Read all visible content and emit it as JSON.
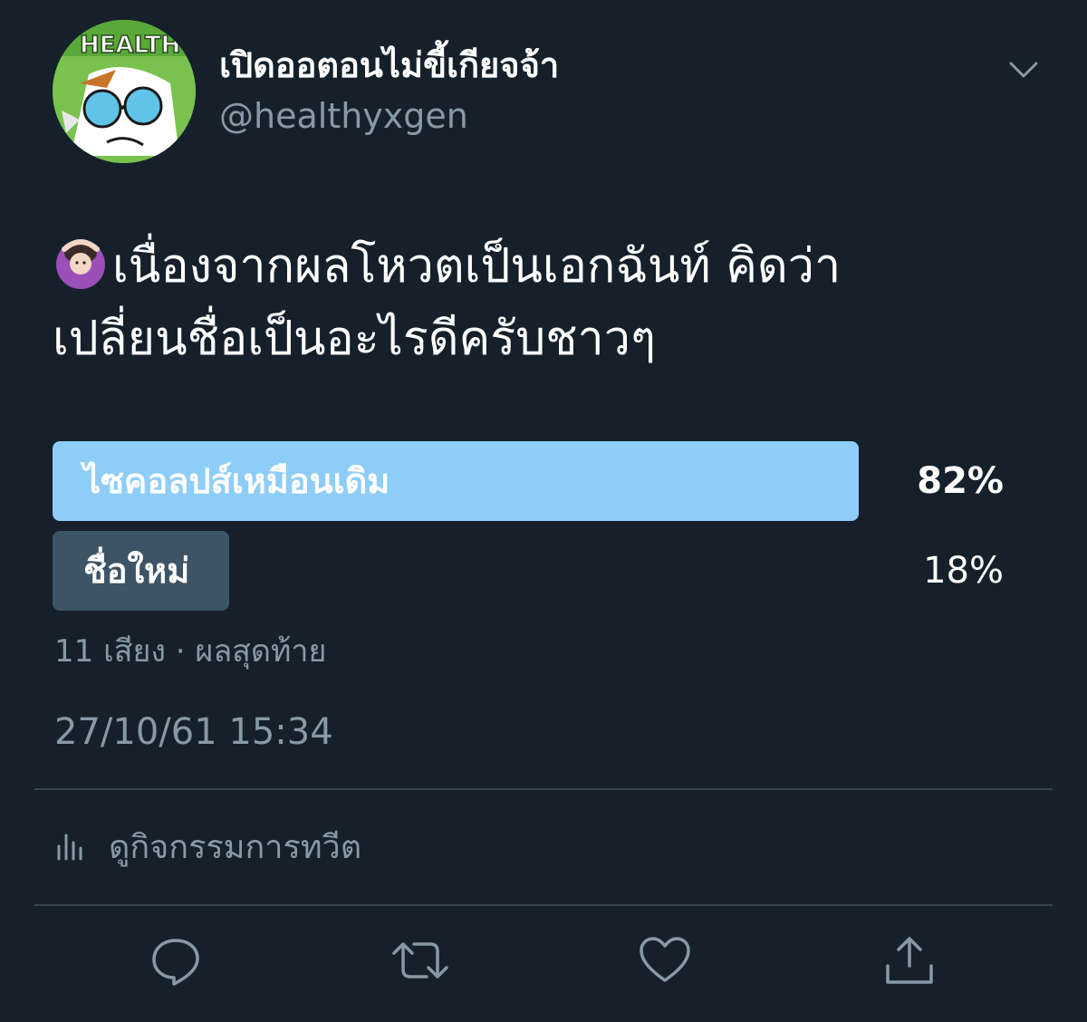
{
  "tweet": {
    "display_name": "เปิดออตอนไม่ขี้เกียจจ้า",
    "handle": "@healthyxgen",
    "avatar_text": "HEALTH",
    "emoji": "woman-gesturing-ok",
    "text_line_1": "เนื่องจากผลโหวตเป็นเอกฉันท์ คิดว่า",
    "text_line_2": "เปลี่ยนชื่อเป็นอะไรดีครับชาวๆ"
  },
  "poll": {
    "options": [
      {
        "label": "ไซคอลปส์เหมือนเดิม",
        "percent": "82%",
        "fraction": 0.82,
        "winner": true
      },
      {
        "label": "ชื่อใหม่",
        "percent": "18%",
        "fraction": 0.18,
        "winner": false
      }
    ],
    "votes_summary": "11 เสียง · ผลสุดท้าย"
  },
  "timestamp": "27/10/61 15:34",
  "activity_label": "ดูกิจกรรมการทวีต",
  "actions": [
    "reply-icon",
    "retweet-icon",
    "like-icon",
    "share-icon"
  ],
  "colors": {
    "background": "#15202b",
    "winner_bar": "#8ecdf8",
    "loser_bar": "#3d5466",
    "secondary_text": "#8899a6",
    "divider": "#38444d"
  }
}
